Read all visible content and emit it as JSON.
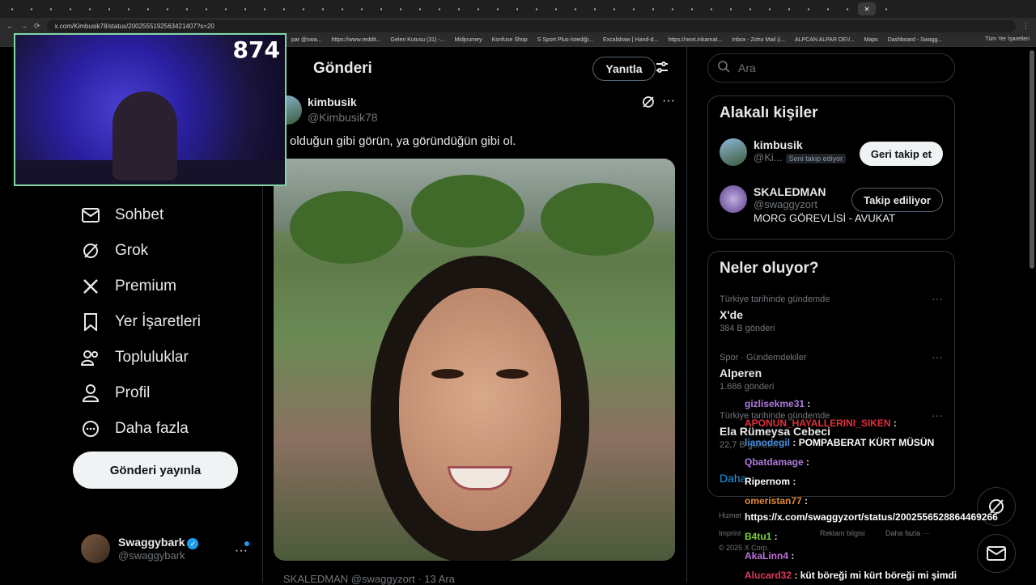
{
  "browser": {
    "url": "x.com/Kimbusik78/status/2002555192563421407?s=20",
    "bookmarks": [
      "par @swa...",
      "https://www.reddit...",
      "Gelen Kutusu (31) -...",
      "Midjourney",
      "Konfuse Shop",
      "S Sport Plus-İstediği...",
      "Excalidraw | Hand-d...",
      "https://next.inkarnat...",
      "Inbox - Zoho Mail (i...",
      "ALPCAN ALPAR DEV...",
      "Maps",
      "Dashboard - Swagg..."
    ],
    "bookmarks_right": "Tüm Yer İşaretleri"
  },
  "webcam": {
    "count": "874"
  },
  "nav": {
    "items": [
      {
        "label": "Sohbet",
        "icon": "envelope-icon"
      },
      {
        "label": "Grok",
        "icon": "grok-icon"
      },
      {
        "label": "Premium",
        "icon": "x-logo-icon"
      },
      {
        "label": "Yer İşaretleri",
        "icon": "bookmark-icon"
      },
      {
        "label": "Topluluklar",
        "icon": "people-icon"
      },
      {
        "label": "Profil",
        "icon": "person-icon"
      },
      {
        "label": "Daha fazla",
        "icon": "more-circle-icon"
      }
    ],
    "post_button": "Gönderi yayınla",
    "account": {
      "name": "Swaggybark",
      "handle": "@swaggybark"
    }
  },
  "main": {
    "header": "Gönderi",
    "reply_button": "Yanıtla",
    "tweet": {
      "name": "kimbusik",
      "handle": "@Kimbusik78",
      "text": "olduğun gibi görün, ya göründüğün gibi ol."
    },
    "next_tweet": "SKALEDMAN @swaggyzort · 13 Ara"
  },
  "sidebar": {
    "search_placeholder": "Ara",
    "related_title": "Alakalı kişiler",
    "people": [
      {
        "name": "kimbusik",
        "handle": "@Ki...",
        "badge": "Seni takip ediyor",
        "button": "Geri takip et"
      },
      {
        "name": "SKALEDMAN",
        "handle": "@swaggyzort",
        "bio": "MORG GÖREVLİSİ - AVUKAT",
        "button": "Takip ediliyor"
      }
    ],
    "trends_title": "Neler oluyor?",
    "trends": [
      {
        "context": "Türkiye tarihinde gündemde",
        "name": "X'de",
        "count": "384 B gönderi"
      },
      {
        "context": "Spor · Gündemdekiler",
        "name": "Alperen",
        "count": "1.686 gönderi"
      },
      {
        "context": "Türkiye tarihinde gündemde",
        "name": "Ela Rümeysa Cebeci",
        "count": "22,7 B gönderi"
      }
    ],
    "show_more": "Daha",
    "footer": [
      "Hizmet",
      "Imprint",
      "Reklam bilgisi",
      "Daha fazla ···",
      "© 2025 X Corp."
    ]
  },
  "chat": [
    {
      "user": "gizlisekme31",
      "msg": "",
      "color": "#b07ae0"
    },
    {
      "user": "APONUN_HAYALLERINI_SIKEN",
      "msg": "",
      "color": "#e0303a"
    },
    {
      "user": "lianodegil",
      "msg": "POMPABERAT KÜRT MÜSÜN",
      "color": "#4a90e0"
    },
    {
      "user": "Qbatdamage",
      "msg": "",
      "color": "#b07ae0"
    },
    {
      "user": "Ripernom",
      "msg": "",
      "color": "#ffffff"
    },
    {
      "user": "omeristan77",
      "msg": "",
      "color": "#e08a3a"
    },
    {
      "user": "",
      "msg": "https://x.com/swaggyzort/status/2002556528864469266",
      "color": "#ffffff"
    },
    {
      "user": "B4tu1",
      "msg": "",
      "color": "#7ad03a"
    },
    {
      "user": "AkaLinn4",
      "msg": "",
      "color": "#c070e0"
    },
    {
      "user": "Alucard32",
      "msg": "küt böreği mi kürt böreği mi şimdi",
      "color": "#e03a5a"
    }
  ],
  "colors": {
    "accent": "#1d9bf0",
    "bg": "#000000",
    "border": "#2f3336"
  }
}
